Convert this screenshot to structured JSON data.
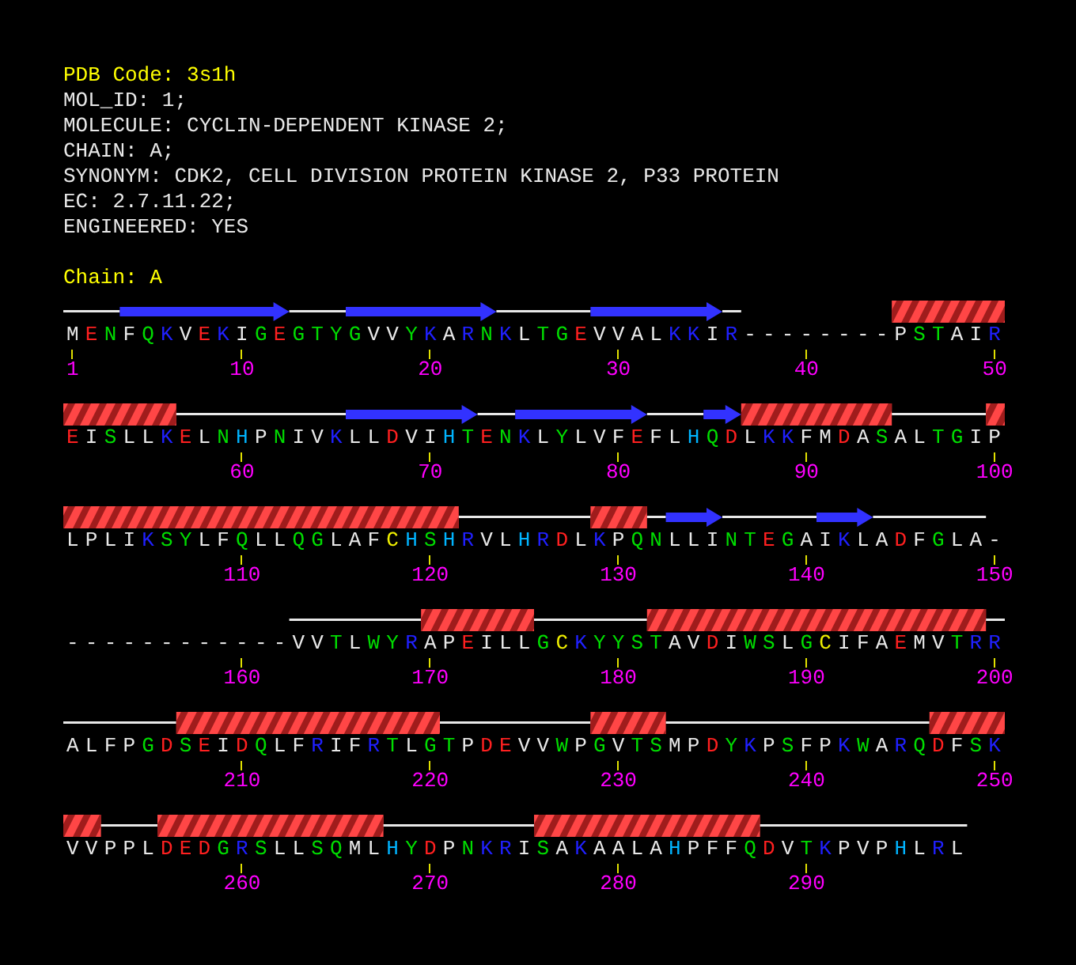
{
  "header": {
    "pdb_code": "PDB Code: 3s1h",
    "lines": [
      "MOL_ID: 1;",
      "MOLECULE: CYCLIN-DEPENDENT KINASE 2;",
      "CHAIN: A;",
      "SYNONYM: CDK2, CELL DIVISION PROTEIN KINASE 2, P33 PROTEIN",
      "EC: 2.7.11.22;",
      "ENGINEERED: YES"
    ],
    "chain": "Chain: A"
  },
  "rows": [
    {
      "residues": [
        {
          "aa": "M",
          "color": "#e8e8e8",
          "kind": "coil",
          "number": "1"
        },
        {
          "aa": "E",
          "color": "#ff2020",
          "kind": "coil"
        },
        {
          "aa": "N",
          "color": "#00dd00",
          "kind": "coil"
        },
        {
          "aa": "F",
          "color": "#e8e8e8",
          "kind": "strand"
        },
        {
          "aa": "Q",
          "color": "#00dd00",
          "kind": "strand"
        },
        {
          "aa": "K",
          "color": "#2020ff",
          "kind": "strand"
        },
        {
          "aa": "V",
          "color": "#e8e8e8",
          "kind": "strand"
        },
        {
          "aa": "E",
          "color": "#ff2020",
          "kind": "strand"
        },
        {
          "aa": "K",
          "color": "#2020ff",
          "kind": "strand"
        },
        {
          "aa": "I",
          "color": "#e8e8e8",
          "kind": "strand",
          "number": "10"
        },
        {
          "aa": "G",
          "color": "#00dd00",
          "kind": "strand"
        },
        {
          "aa": "E",
          "color": "#ff2020",
          "kind": "strand"
        },
        {
          "aa": "G",
          "color": "#00dd00",
          "kind": "coil"
        },
        {
          "aa": "T",
          "color": "#00dd00",
          "kind": "coil"
        },
        {
          "aa": "Y",
          "color": "#00dd00",
          "kind": "coil"
        },
        {
          "aa": "G",
          "color": "#00dd00",
          "kind": "strand"
        },
        {
          "aa": "V",
          "color": "#e8e8e8",
          "kind": "strand"
        },
        {
          "aa": "V",
          "color": "#e8e8e8",
          "kind": "strand"
        },
        {
          "aa": "Y",
          "color": "#00dd00",
          "kind": "strand"
        },
        {
          "aa": "K",
          "color": "#2020ff",
          "kind": "strand",
          "number": "20"
        },
        {
          "aa": "A",
          "color": "#e8e8e8",
          "kind": "strand"
        },
        {
          "aa": "R",
          "color": "#2020ff",
          "kind": "strand"
        },
        {
          "aa": "N",
          "color": "#00dd00",
          "kind": "strand"
        },
        {
          "aa": "K",
          "color": "#2020ff",
          "kind": "coil"
        },
        {
          "aa": "L",
          "color": "#e8e8e8",
          "kind": "coil"
        },
        {
          "aa": "T",
          "color": "#00dd00",
          "kind": "coil"
        },
        {
          "aa": "G",
          "color": "#00dd00",
          "kind": "coil"
        },
        {
          "aa": "E",
          "color": "#ff2020",
          "kind": "coil"
        },
        {
          "aa": "V",
          "color": "#e8e8e8",
          "kind": "strand"
        },
        {
          "aa": "V",
          "color": "#e8e8e8",
          "kind": "strand",
          "number": "30"
        },
        {
          "aa": "A",
          "color": "#e8e8e8",
          "kind": "strand"
        },
        {
          "aa": "L",
          "color": "#e8e8e8",
          "kind": "strand"
        },
        {
          "aa": "K",
          "color": "#2020ff",
          "kind": "strand"
        },
        {
          "aa": "K",
          "color": "#2020ff",
          "kind": "strand"
        },
        {
          "aa": "I",
          "color": "#e8e8e8",
          "kind": "strand"
        },
        {
          "aa": "R",
          "color": "#2020ff",
          "kind": "coil"
        },
        {
          "aa": "-",
          "color": "#e8e8e8",
          "kind": "gap"
        },
        {
          "aa": "-",
          "color": "#e8e8e8",
          "kind": "gap"
        },
        {
          "aa": "-",
          "color": "#e8e8e8",
          "kind": "gap"
        },
        {
          "aa": "-",
          "color": "#e8e8e8",
          "kind": "gap",
          "number": "40"
        },
        {
          "aa": "-",
          "color": "#e8e8e8",
          "kind": "gap"
        },
        {
          "aa": "-",
          "color": "#e8e8e8",
          "kind": "gap"
        },
        {
          "aa": "-",
          "color": "#e8e8e8",
          "kind": "gap"
        },
        {
          "aa": "-",
          "color": "#e8e8e8",
          "kind": "gap"
        },
        {
          "aa": "P",
          "color": "#e8e8e8",
          "kind": "helix"
        },
        {
          "aa": "S",
          "color": "#00dd00",
          "kind": "helix"
        },
        {
          "aa": "T",
          "color": "#00dd00",
          "kind": "helix"
        },
        {
          "aa": "A",
          "color": "#e8e8e8",
          "kind": "helix"
        },
        {
          "aa": "I",
          "color": "#e8e8e8",
          "kind": "helix"
        },
        {
          "aa": "R",
          "color": "#2020ff",
          "kind": "helix",
          "number": "50"
        }
      ]
    },
    {
      "residues": [
        {
          "aa": "E",
          "color": "#ff2020",
          "kind": "helix"
        },
        {
          "aa": "I",
          "color": "#e8e8e8",
          "kind": "helix"
        },
        {
          "aa": "S",
          "color": "#00dd00",
          "kind": "helix"
        },
        {
          "aa": "L",
          "color": "#e8e8e8",
          "kind": "helix"
        },
        {
          "aa": "L",
          "color": "#e8e8e8",
          "kind": "helix"
        },
        {
          "aa": "K",
          "color": "#2020ff",
          "kind": "helix"
        },
        {
          "aa": "E",
          "color": "#ff2020",
          "kind": "coil"
        },
        {
          "aa": "L",
          "color": "#e8e8e8",
          "kind": "coil"
        },
        {
          "aa": "N",
          "color": "#00dd00",
          "kind": "coil"
        },
        {
          "aa": "H",
          "color": "#00b4ff",
          "kind": "coil",
          "number": "60"
        },
        {
          "aa": "P",
          "color": "#e8e8e8",
          "kind": "coil"
        },
        {
          "aa": "N",
          "color": "#00dd00",
          "kind": "coil"
        },
        {
          "aa": "I",
          "color": "#e8e8e8",
          "kind": "coil"
        },
        {
          "aa": "V",
          "color": "#e8e8e8",
          "kind": "coil"
        },
        {
          "aa": "K",
          "color": "#2020ff",
          "kind": "coil"
        },
        {
          "aa": "L",
          "color": "#e8e8e8",
          "kind": "strand"
        },
        {
          "aa": "L",
          "color": "#e8e8e8",
          "kind": "strand"
        },
        {
          "aa": "D",
          "color": "#ff2020",
          "kind": "strand"
        },
        {
          "aa": "V",
          "color": "#e8e8e8",
          "kind": "strand"
        },
        {
          "aa": "I",
          "color": "#e8e8e8",
          "kind": "strand",
          "number": "70"
        },
        {
          "aa": "H",
          "color": "#00b4ff",
          "kind": "strand"
        },
        {
          "aa": "T",
          "color": "#00dd00",
          "kind": "strand"
        },
        {
          "aa": "E",
          "color": "#ff2020",
          "kind": "coil"
        },
        {
          "aa": "N",
          "color": "#00dd00",
          "kind": "coil"
        },
        {
          "aa": "K",
          "color": "#2020ff",
          "kind": "strand"
        },
        {
          "aa": "L",
          "color": "#e8e8e8",
          "kind": "strand"
        },
        {
          "aa": "Y",
          "color": "#00dd00",
          "kind": "strand"
        },
        {
          "aa": "L",
          "color": "#e8e8e8",
          "kind": "strand"
        },
        {
          "aa": "V",
          "color": "#e8e8e8",
          "kind": "strand"
        },
        {
          "aa": "F",
          "color": "#e8e8e8",
          "kind": "strand",
          "number": "80"
        },
        {
          "aa": "E",
          "color": "#ff2020",
          "kind": "strand"
        },
        {
          "aa": "F",
          "color": "#e8e8e8",
          "kind": "coil"
        },
        {
          "aa": "L",
          "color": "#e8e8e8",
          "kind": "coil"
        },
        {
          "aa": "H",
          "color": "#00b4ff",
          "kind": "coil"
        },
        {
          "aa": "Q",
          "color": "#00dd00",
          "kind": "strand"
        },
        {
          "aa": "D",
          "color": "#ff2020",
          "kind": "strand"
        },
        {
          "aa": "L",
          "color": "#e8e8e8",
          "kind": "helix"
        },
        {
          "aa": "K",
          "color": "#2020ff",
          "kind": "helix"
        },
        {
          "aa": "K",
          "color": "#2020ff",
          "kind": "helix"
        },
        {
          "aa": "F",
          "color": "#e8e8e8",
          "kind": "helix",
          "number": "90"
        },
        {
          "aa": "M",
          "color": "#e8e8e8",
          "kind": "helix"
        },
        {
          "aa": "D",
          "color": "#ff2020",
          "kind": "helix"
        },
        {
          "aa": "A",
          "color": "#e8e8e8",
          "kind": "helix"
        },
        {
          "aa": "S",
          "color": "#00dd00",
          "kind": "helix"
        },
        {
          "aa": "A",
          "color": "#e8e8e8",
          "kind": "coil"
        },
        {
          "aa": "L",
          "color": "#e8e8e8",
          "kind": "coil"
        },
        {
          "aa": "T",
          "color": "#00dd00",
          "kind": "coil"
        },
        {
          "aa": "G",
          "color": "#00dd00",
          "kind": "coil"
        },
        {
          "aa": "I",
          "color": "#e8e8e8",
          "kind": "coil"
        },
        {
          "aa": "P",
          "color": "#e8e8e8",
          "kind": "helix",
          "number": "100"
        }
      ]
    },
    {
      "residues": [
        {
          "aa": "L",
          "color": "#e8e8e8",
          "kind": "helix"
        },
        {
          "aa": "P",
          "color": "#e8e8e8",
          "kind": "helix"
        },
        {
          "aa": "L",
          "color": "#e8e8e8",
          "kind": "helix"
        },
        {
          "aa": "I",
          "color": "#e8e8e8",
          "kind": "helix"
        },
        {
          "aa": "K",
          "color": "#2020ff",
          "kind": "helix"
        },
        {
          "aa": "S",
          "color": "#00dd00",
          "kind": "helix"
        },
        {
          "aa": "Y",
          "color": "#00dd00",
          "kind": "helix"
        },
        {
          "aa": "L",
          "color": "#e8e8e8",
          "kind": "helix"
        },
        {
          "aa": "F",
          "color": "#e8e8e8",
          "kind": "helix"
        },
        {
          "aa": "Q",
          "color": "#00dd00",
          "kind": "helix",
          "number": "110"
        },
        {
          "aa": "L",
          "color": "#e8e8e8",
          "kind": "helix"
        },
        {
          "aa": "L",
          "color": "#e8e8e8",
          "kind": "helix"
        },
        {
          "aa": "Q",
          "color": "#00dd00",
          "kind": "helix"
        },
        {
          "aa": "G",
          "color": "#00dd00",
          "kind": "helix"
        },
        {
          "aa": "L",
          "color": "#e8e8e8",
          "kind": "helix"
        },
        {
          "aa": "A",
          "color": "#e8e8e8",
          "kind": "helix"
        },
        {
          "aa": "F",
          "color": "#e8e8e8",
          "kind": "helix"
        },
        {
          "aa": "C",
          "color": "#eeee00",
          "kind": "helix"
        },
        {
          "aa": "H",
          "color": "#00b4ff",
          "kind": "helix"
        },
        {
          "aa": "S",
          "color": "#00dd00",
          "kind": "helix",
          "number": "120"
        },
        {
          "aa": "H",
          "color": "#00b4ff",
          "kind": "helix"
        },
        {
          "aa": "R",
          "color": "#2020ff",
          "kind": "coil"
        },
        {
          "aa": "V",
          "color": "#e8e8e8",
          "kind": "coil"
        },
        {
          "aa": "L",
          "color": "#e8e8e8",
          "kind": "coil"
        },
        {
          "aa": "H",
          "color": "#00b4ff",
          "kind": "coil"
        },
        {
          "aa": "R",
          "color": "#2020ff",
          "kind": "coil"
        },
        {
          "aa": "D",
          "color": "#ff2020",
          "kind": "coil"
        },
        {
          "aa": "L",
          "color": "#e8e8e8",
          "kind": "coil"
        },
        {
          "aa": "K",
          "color": "#2020ff",
          "kind": "helix"
        },
        {
          "aa": "P",
          "color": "#e8e8e8",
          "kind": "helix",
          "number": "130"
        },
        {
          "aa": "Q",
          "color": "#00dd00",
          "kind": "helix"
        },
        {
          "aa": "N",
          "color": "#00dd00",
          "kind": "coil"
        },
        {
          "aa": "L",
          "color": "#e8e8e8",
          "kind": "strand"
        },
        {
          "aa": "L",
          "color": "#e8e8e8",
          "kind": "strand"
        },
        {
          "aa": "I",
          "color": "#e8e8e8",
          "kind": "strand"
        },
        {
          "aa": "N",
          "color": "#00dd00",
          "kind": "coil"
        },
        {
          "aa": "T",
          "color": "#00dd00",
          "kind": "coil"
        },
        {
          "aa": "E",
          "color": "#ff2020",
          "kind": "coil"
        },
        {
          "aa": "G",
          "color": "#00dd00",
          "kind": "coil"
        },
        {
          "aa": "A",
          "color": "#e8e8e8",
          "kind": "coil",
          "number": "140"
        },
        {
          "aa": "I",
          "color": "#e8e8e8",
          "kind": "strand"
        },
        {
          "aa": "K",
          "color": "#2020ff",
          "kind": "strand"
        },
        {
          "aa": "L",
          "color": "#e8e8e8",
          "kind": "strand"
        },
        {
          "aa": "A",
          "color": "#e8e8e8",
          "kind": "coil"
        },
        {
          "aa": "D",
          "color": "#ff2020",
          "kind": "coil"
        },
        {
          "aa": "F",
          "color": "#e8e8e8",
          "kind": "coil"
        },
        {
          "aa": "G",
          "color": "#00dd00",
          "kind": "coil"
        },
        {
          "aa": "L",
          "color": "#e8e8e8",
          "kind": "coil"
        },
        {
          "aa": "A",
          "color": "#e8e8e8",
          "kind": "coil"
        },
        {
          "aa": "-",
          "color": "#e8e8e8",
          "kind": "gap",
          "number": "150"
        }
      ]
    },
    {
      "residues": [
        {
          "aa": "-",
          "color": "#e8e8e8",
          "kind": "gap"
        },
        {
          "aa": "-",
          "color": "#e8e8e8",
          "kind": "gap"
        },
        {
          "aa": "-",
          "color": "#e8e8e8",
          "kind": "gap"
        },
        {
          "aa": "-",
          "color": "#e8e8e8",
          "kind": "gap"
        },
        {
          "aa": "-",
          "color": "#e8e8e8",
          "kind": "gap"
        },
        {
          "aa": "-",
          "color": "#e8e8e8",
          "kind": "gap"
        },
        {
          "aa": "-",
          "color": "#e8e8e8",
          "kind": "gap"
        },
        {
          "aa": "-",
          "color": "#e8e8e8",
          "kind": "gap"
        },
        {
          "aa": "-",
          "color": "#e8e8e8",
          "kind": "gap"
        },
        {
          "aa": "-",
          "color": "#e8e8e8",
          "kind": "gap",
          "number": "160"
        },
        {
          "aa": "-",
          "color": "#e8e8e8",
          "kind": "gap"
        },
        {
          "aa": "-",
          "color": "#e8e8e8",
          "kind": "gap"
        },
        {
          "aa": "V",
          "color": "#e8e8e8",
          "kind": "coil"
        },
        {
          "aa": "V",
          "color": "#e8e8e8",
          "kind": "coil"
        },
        {
          "aa": "T",
          "color": "#00dd00",
          "kind": "coil"
        },
        {
          "aa": "L",
          "color": "#e8e8e8",
          "kind": "coil"
        },
        {
          "aa": "W",
          "color": "#00dd00",
          "kind": "coil"
        },
        {
          "aa": "Y",
          "color": "#00dd00",
          "kind": "coil"
        },
        {
          "aa": "R",
          "color": "#2020ff",
          "kind": "coil"
        },
        {
          "aa": "A",
          "color": "#e8e8e8",
          "kind": "helix",
          "number": "170"
        },
        {
          "aa": "P",
          "color": "#e8e8e8",
          "kind": "helix"
        },
        {
          "aa": "E",
          "color": "#ff2020",
          "kind": "helix"
        },
        {
          "aa": "I",
          "color": "#e8e8e8",
          "kind": "helix"
        },
        {
          "aa": "L",
          "color": "#e8e8e8",
          "kind": "helix"
        },
        {
          "aa": "L",
          "color": "#e8e8e8",
          "kind": "helix"
        },
        {
          "aa": "G",
          "color": "#00dd00",
          "kind": "coil"
        },
        {
          "aa": "C",
          "color": "#eeee00",
          "kind": "coil"
        },
        {
          "aa": "K",
          "color": "#2020ff",
          "kind": "coil"
        },
        {
          "aa": "Y",
          "color": "#00dd00",
          "kind": "coil"
        },
        {
          "aa": "Y",
          "color": "#00dd00",
          "kind": "coil",
          "number": "180"
        },
        {
          "aa": "S",
          "color": "#00dd00",
          "kind": "coil"
        },
        {
          "aa": "T",
          "color": "#00dd00",
          "kind": "helix"
        },
        {
          "aa": "A",
          "color": "#e8e8e8",
          "kind": "helix"
        },
        {
          "aa": "V",
          "color": "#e8e8e8",
          "kind": "helix"
        },
        {
          "aa": "D",
          "color": "#ff2020",
          "kind": "helix"
        },
        {
          "aa": "I",
          "color": "#e8e8e8",
          "kind": "helix"
        },
        {
          "aa": "W",
          "color": "#00dd00",
          "kind": "helix"
        },
        {
          "aa": "S",
          "color": "#00dd00",
          "kind": "helix"
        },
        {
          "aa": "L",
          "color": "#e8e8e8",
          "kind": "helix"
        },
        {
          "aa": "G",
          "color": "#00dd00",
          "kind": "helix",
          "number": "190"
        },
        {
          "aa": "C",
          "color": "#eeee00",
          "kind": "helix"
        },
        {
          "aa": "I",
          "color": "#e8e8e8",
          "kind": "helix"
        },
        {
          "aa": "F",
          "color": "#e8e8e8",
          "kind": "helix"
        },
        {
          "aa": "A",
          "color": "#e8e8e8",
          "kind": "helix"
        },
        {
          "aa": "E",
          "color": "#ff2020",
          "kind": "helix"
        },
        {
          "aa": "M",
          "color": "#e8e8e8",
          "kind": "helix"
        },
        {
          "aa": "V",
          "color": "#e8e8e8",
          "kind": "helix"
        },
        {
          "aa": "T",
          "color": "#00dd00",
          "kind": "helix"
        },
        {
          "aa": "R",
          "color": "#2020ff",
          "kind": "helix"
        },
        {
          "aa": "R",
          "color": "#2020ff",
          "kind": "coil",
          "number": "200"
        }
      ]
    },
    {
      "residues": [
        {
          "aa": "A",
          "color": "#e8e8e8",
          "kind": "coil"
        },
        {
          "aa": "L",
          "color": "#e8e8e8",
          "kind": "coil"
        },
        {
          "aa": "F",
          "color": "#e8e8e8",
          "kind": "coil"
        },
        {
          "aa": "P",
          "color": "#e8e8e8",
          "kind": "coil"
        },
        {
          "aa": "G",
          "color": "#00dd00",
          "kind": "coil"
        },
        {
          "aa": "D",
          "color": "#ff2020",
          "kind": "coil"
        },
        {
          "aa": "S",
          "color": "#00dd00",
          "kind": "helix"
        },
        {
          "aa": "E",
          "color": "#ff2020",
          "kind": "helix"
        },
        {
          "aa": "I",
          "color": "#e8e8e8",
          "kind": "helix"
        },
        {
          "aa": "D",
          "color": "#ff2020",
          "kind": "helix",
          "number": "210"
        },
        {
          "aa": "Q",
          "color": "#00dd00",
          "kind": "helix"
        },
        {
          "aa": "L",
          "color": "#e8e8e8",
          "kind": "helix"
        },
        {
          "aa": "F",
          "color": "#e8e8e8",
          "kind": "helix"
        },
        {
          "aa": "R",
          "color": "#2020ff",
          "kind": "helix"
        },
        {
          "aa": "I",
          "color": "#e8e8e8",
          "kind": "helix"
        },
        {
          "aa": "F",
          "color": "#e8e8e8",
          "kind": "helix"
        },
        {
          "aa": "R",
          "color": "#2020ff",
          "kind": "helix"
        },
        {
          "aa": "T",
          "color": "#00dd00",
          "kind": "helix"
        },
        {
          "aa": "L",
          "color": "#e8e8e8",
          "kind": "helix"
        },
        {
          "aa": "G",
          "color": "#00dd00",
          "kind": "helix",
          "number": "220"
        },
        {
          "aa": "T",
          "color": "#00dd00",
          "kind": "coil"
        },
        {
          "aa": "P",
          "color": "#e8e8e8",
          "kind": "coil"
        },
        {
          "aa": "D",
          "color": "#ff2020",
          "kind": "coil"
        },
        {
          "aa": "E",
          "color": "#ff2020",
          "kind": "coil"
        },
        {
          "aa": "V",
          "color": "#e8e8e8",
          "kind": "coil"
        },
        {
          "aa": "V",
          "color": "#e8e8e8",
          "kind": "coil"
        },
        {
          "aa": "W",
          "color": "#00dd00",
          "kind": "coil"
        },
        {
          "aa": "P",
          "color": "#e8e8e8",
          "kind": "coil"
        },
        {
          "aa": "G",
          "color": "#00dd00",
          "kind": "helix"
        },
        {
          "aa": "V",
          "color": "#e8e8e8",
          "kind": "helix",
          "number": "230"
        },
        {
          "aa": "T",
          "color": "#00dd00",
          "kind": "helix"
        },
        {
          "aa": "S",
          "color": "#00dd00",
          "kind": "helix"
        },
        {
          "aa": "M",
          "color": "#e8e8e8",
          "kind": "coil"
        },
        {
          "aa": "P",
          "color": "#e8e8e8",
          "kind": "coil"
        },
        {
          "aa": "D",
          "color": "#ff2020",
          "kind": "coil"
        },
        {
          "aa": "Y",
          "color": "#00dd00",
          "kind": "coil"
        },
        {
          "aa": "K",
          "color": "#2020ff",
          "kind": "coil"
        },
        {
          "aa": "P",
          "color": "#e8e8e8",
          "kind": "coil"
        },
        {
          "aa": "S",
          "color": "#00dd00",
          "kind": "coil"
        },
        {
          "aa": "F",
          "color": "#e8e8e8",
          "kind": "coil",
          "number": "240"
        },
        {
          "aa": "P",
          "color": "#e8e8e8",
          "kind": "coil"
        },
        {
          "aa": "K",
          "color": "#2020ff",
          "kind": "coil"
        },
        {
          "aa": "W",
          "color": "#00dd00",
          "kind": "coil"
        },
        {
          "aa": "A",
          "color": "#e8e8e8",
          "kind": "coil"
        },
        {
          "aa": "R",
          "color": "#2020ff",
          "kind": "coil"
        },
        {
          "aa": "Q",
          "color": "#00dd00",
          "kind": "coil"
        },
        {
          "aa": "D",
          "color": "#ff2020",
          "kind": "helix"
        },
        {
          "aa": "F",
          "color": "#e8e8e8",
          "kind": "helix"
        },
        {
          "aa": "S",
          "color": "#00dd00",
          "kind": "helix"
        },
        {
          "aa": "K",
          "color": "#2020ff",
          "kind": "helix",
          "number": "250"
        }
      ]
    },
    {
      "residues": [
        {
          "aa": "V",
          "color": "#e8e8e8",
          "kind": "helix"
        },
        {
          "aa": "V",
          "color": "#e8e8e8",
          "kind": "helix"
        },
        {
          "aa": "P",
          "color": "#e8e8e8",
          "kind": "coil"
        },
        {
          "aa": "P",
          "color": "#e8e8e8",
          "kind": "coil"
        },
        {
          "aa": "L",
          "color": "#e8e8e8",
          "kind": "coil"
        },
        {
          "aa": "D",
          "color": "#ff2020",
          "kind": "helix"
        },
        {
          "aa": "E",
          "color": "#ff2020",
          "kind": "helix"
        },
        {
          "aa": "D",
          "color": "#ff2020",
          "kind": "helix"
        },
        {
          "aa": "G",
          "color": "#00dd00",
          "kind": "helix"
        },
        {
          "aa": "R",
          "color": "#2020ff",
          "kind": "helix",
          "number": "260"
        },
        {
          "aa": "S",
          "color": "#00dd00",
          "kind": "helix"
        },
        {
          "aa": "L",
          "color": "#e8e8e8",
          "kind": "helix"
        },
        {
          "aa": "L",
          "color": "#e8e8e8",
          "kind": "helix"
        },
        {
          "aa": "S",
          "color": "#00dd00",
          "kind": "helix"
        },
        {
          "aa": "Q",
          "color": "#00dd00",
          "kind": "helix"
        },
        {
          "aa": "M",
          "color": "#e8e8e8",
          "kind": "helix"
        },
        {
          "aa": "L",
          "color": "#e8e8e8",
          "kind": "helix"
        },
        {
          "aa": "H",
          "color": "#00b4ff",
          "kind": "coil"
        },
        {
          "aa": "Y",
          "color": "#00dd00",
          "kind": "coil"
        },
        {
          "aa": "D",
          "color": "#ff2020",
          "kind": "coil",
          "number": "270"
        },
        {
          "aa": "P",
          "color": "#e8e8e8",
          "kind": "coil"
        },
        {
          "aa": "N",
          "color": "#00dd00",
          "kind": "coil"
        },
        {
          "aa": "K",
          "color": "#2020ff",
          "kind": "coil"
        },
        {
          "aa": "R",
          "color": "#2020ff",
          "kind": "coil"
        },
        {
          "aa": "I",
          "color": "#e8e8e8",
          "kind": "coil"
        },
        {
          "aa": "S",
          "color": "#00dd00",
          "kind": "helix"
        },
        {
          "aa": "A",
          "color": "#e8e8e8",
          "kind": "helix"
        },
        {
          "aa": "K",
          "color": "#2020ff",
          "kind": "helix"
        },
        {
          "aa": "A",
          "color": "#e8e8e8",
          "kind": "helix"
        },
        {
          "aa": "A",
          "color": "#e8e8e8",
          "kind": "helix",
          "number": "280"
        },
        {
          "aa": "L",
          "color": "#e8e8e8",
          "kind": "helix"
        },
        {
          "aa": "A",
          "color": "#e8e8e8",
          "kind": "helix"
        },
        {
          "aa": "H",
          "color": "#00b4ff",
          "kind": "helix"
        },
        {
          "aa": "P",
          "color": "#e8e8e8",
          "kind": "helix"
        },
        {
          "aa": "F",
          "color": "#e8e8e8",
          "kind": "helix"
        },
        {
          "aa": "F",
          "color": "#e8e8e8",
          "kind": "helix"
        },
        {
          "aa": "Q",
          "color": "#00dd00",
          "kind": "helix"
        },
        {
          "aa": "D",
          "color": "#ff2020",
          "kind": "coil"
        },
        {
          "aa": "V",
          "color": "#e8e8e8",
          "kind": "coil"
        },
        {
          "aa": "T",
          "color": "#00dd00",
          "kind": "coil",
          "number": "290"
        },
        {
          "aa": "K",
          "color": "#2020ff",
          "kind": "coil"
        },
        {
          "aa": "P",
          "color": "#e8e8e8",
          "kind": "coil"
        },
        {
          "aa": "V",
          "color": "#e8e8e8",
          "kind": "coil"
        },
        {
          "aa": "P",
          "color": "#e8e8e8",
          "kind": "coil"
        },
        {
          "aa": "H",
          "color": "#00b4ff",
          "kind": "coil"
        },
        {
          "aa": "L",
          "color": "#e8e8e8",
          "kind": "coil"
        },
        {
          "aa": "R",
          "color": "#2020ff",
          "kind": "coil"
        },
        {
          "aa": "L",
          "color": "#e8e8e8",
          "kind": "coil"
        }
      ]
    }
  ]
}
